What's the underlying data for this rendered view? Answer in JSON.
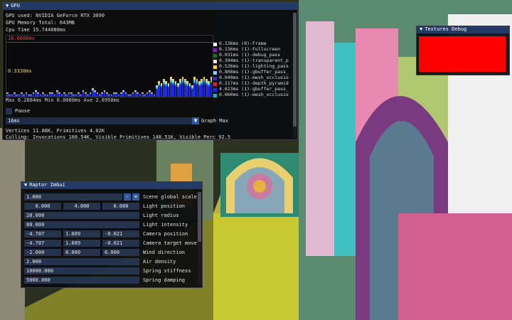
{
  "gpu_window": {
    "title": "GPU",
    "gpu_used": "GPU used: NVIDIA GeForce RTX 3090",
    "gpu_memory": "GPU Memory Total: 643MB",
    "cpu_time": "Cpu Time 15.744080ms",
    "graph_top_label": "16.6666ms",
    "graph_mid_label": "0.3330ms",
    "stats": "Max 6.2884ms   Min 0.0000ms   Ave 2.8958ms",
    "legend": [
      {
        "text": "6.136ms (0)-Frame",
        "color": "#ffffff"
      },
      {
        "text": "0.136ms (1)-Fullscreen",
        "color": "#7a1fb0"
      },
      {
        "text": "0.031ms (1)-debug_pass",
        "color": "#1f6e2a"
      },
      {
        "text": "0.394ms (1)-transparent_p",
        "color": "#e8e8e8"
      },
      {
        "text": "0.526ms (1)-lighting_pass",
        "color": "#f0d050"
      },
      {
        "text": "0.808ms (1)-gbuffer_pass_",
        "color": "#a0c8f0"
      },
      {
        "text": "0.049ms (1)-mesh_occlusio",
        "color": "#3a2ab0"
      },
      {
        "text": "0.217ms (1)-depth_pyramid",
        "color": "#d02a2a"
      },
      {
        "text": "4.623ms (1)-gbuffer_pass_",
        "color": "#1f2ad8"
      },
      {
        "text": "0.060ms (1)-mesh_occlusio",
        "color": "#2ab0b0"
      }
    ],
    "pause_label": "Pause",
    "combo_value": "16ms",
    "combo_label": "Graph Max",
    "vertices": "Vertices 11.88K, Primitives 4.02K",
    "culling": "Culling: Invocations 160.54K, Visible Primitives 148.51K, Visible Perc 92.5"
  },
  "textures_window": {
    "title": "Textures Debug",
    "swatch_color": "#ff0000"
  },
  "raptor_window": {
    "title": "Raptor ImGui",
    "rows": [
      {
        "values": [
          "1.000"
        ],
        "label": "Scene global scale",
        "stepper": true
      },
      {
        "values": [
          "0.000",
          "4.000",
          "0.000"
        ],
        "label": "Light position",
        "centered": true
      },
      {
        "values": [
          "20.000"
        ],
        "label": "Light radius"
      },
      {
        "values": [
          "80.000"
        ],
        "label": "Light intensity"
      },
      {
        "values": [
          "-4.707",
          "1.609",
          "-0.021"
        ],
        "label": "Camera position"
      },
      {
        "values": [
          "-4.707",
          "1.609",
          "-0.021"
        ],
        "label": "Camera target mover"
      },
      {
        "values": [
          "-2.000",
          "0.000",
          "0.000"
        ],
        "label": "Wind direction"
      },
      {
        "values": [
          "2.000"
        ],
        "label": "Air density"
      },
      {
        "values": [
          "10000.000"
        ],
        "label": "Spring stiffness"
      },
      {
        "values": [
          "5000.000"
        ],
        "label": "Spring damping"
      }
    ]
  },
  "graph_bars": [
    2,
    1,
    1,
    2,
    1,
    1,
    2,
    1,
    2,
    1,
    1,
    2,
    3,
    2,
    1,
    2,
    1,
    1,
    2,
    2,
    1,
    3,
    2,
    1,
    2,
    1,
    2,
    2,
    1,
    1,
    2,
    1,
    3,
    2,
    1,
    2,
    4,
    3,
    2,
    1,
    2,
    3,
    2,
    1,
    1,
    2,
    2,
    1,
    2,
    3,
    2,
    1,
    1,
    2,
    3,
    2,
    1,
    2,
    1,
    2,
    3,
    2,
    1,
    5,
    7,
    6,
    8,
    7,
    6,
    9,
    8,
    7,
    6,
    8,
    9,
    8,
    7,
    6,
    5,
    9,
    8,
    7,
    8,
    9,
    8,
    7,
    9
  ]
}
